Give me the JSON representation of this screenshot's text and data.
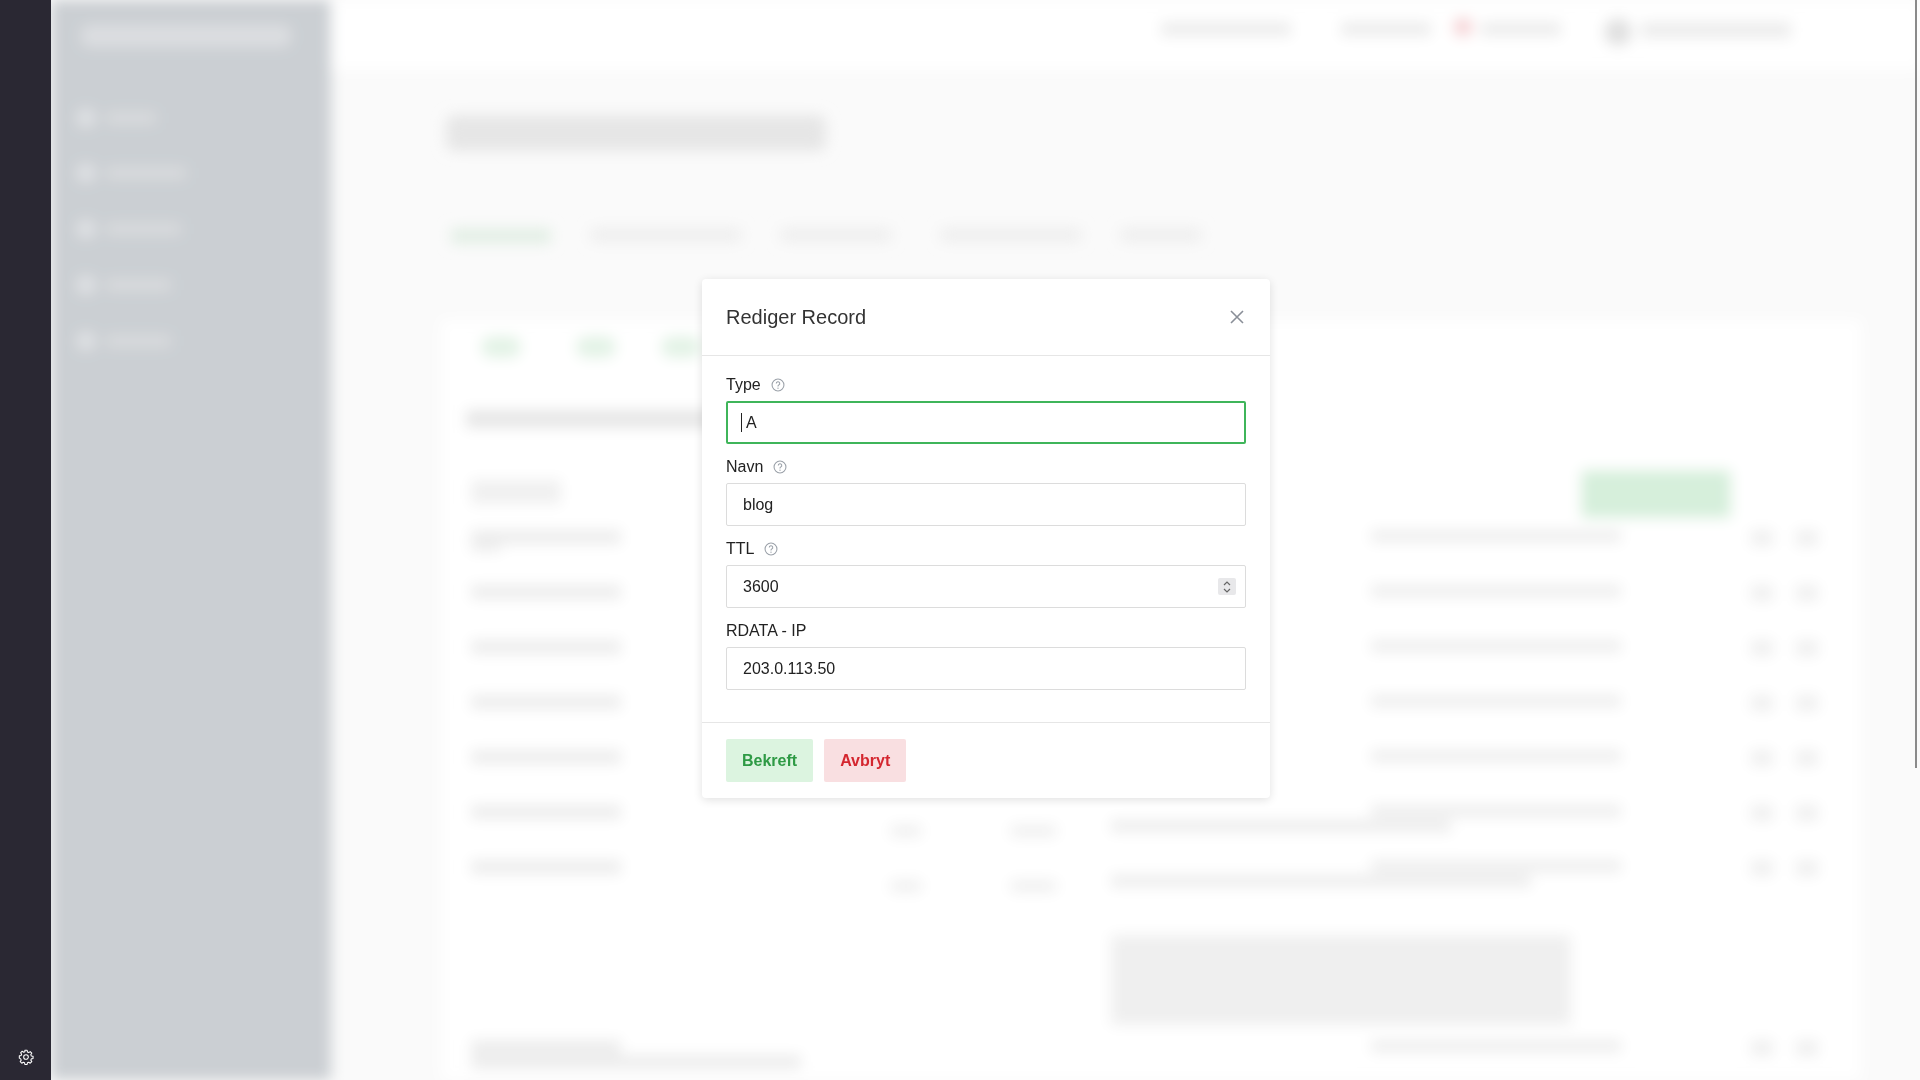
{
  "dialog": {
    "title": "Rediger Record",
    "fields": [
      {
        "label": "Type",
        "help": true,
        "value": "A",
        "focused": true,
        "kind": "text"
      },
      {
        "label": "Navn",
        "help": true,
        "value": "blog",
        "focused": false,
        "kind": "text"
      },
      {
        "label": "TTL",
        "help": true,
        "value": "3600",
        "focused": false,
        "kind": "number"
      },
      {
        "label": "RDATA - IP",
        "help": false,
        "value": "203.0.113.50",
        "focused": false,
        "kind": "text"
      }
    ],
    "buttons": [
      {
        "label": "Bekreft",
        "kind": "confirm"
      },
      {
        "label": "Avbryt",
        "kind": "cancel"
      }
    ]
  }
}
